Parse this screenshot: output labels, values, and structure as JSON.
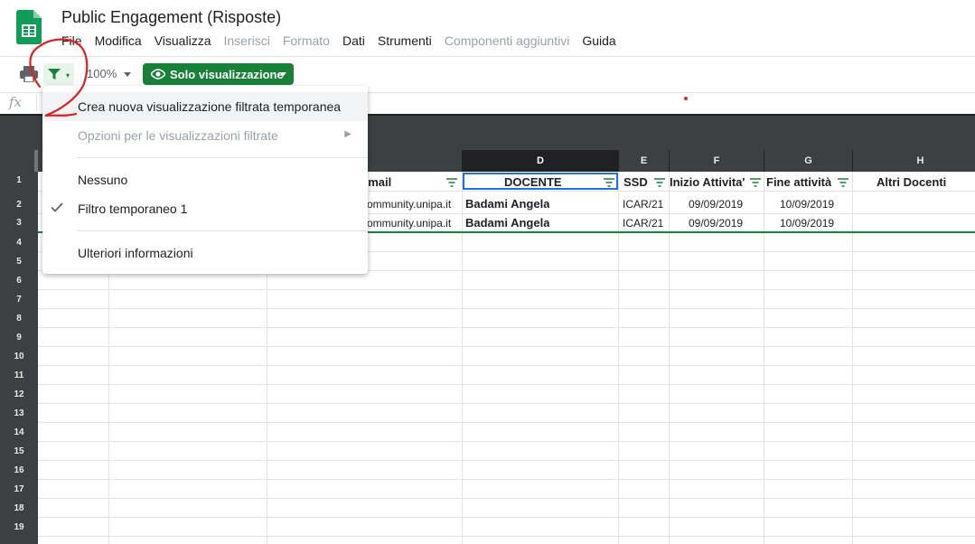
{
  "app": {
    "title": "Public Engagement (Risposte)"
  },
  "menubar": [
    {
      "label": "File",
      "enabled": true
    },
    {
      "label": "Modifica",
      "enabled": true
    },
    {
      "label": "Visualizza",
      "enabled": true
    },
    {
      "label": "Inserisci",
      "enabled": false
    },
    {
      "label": "Formato",
      "enabled": false
    },
    {
      "label": "Dati",
      "enabled": true
    },
    {
      "label": "Strumenti",
      "enabled": true
    },
    {
      "label": "Componenti aggiuntivi",
      "enabled": false
    },
    {
      "label": "Guida",
      "enabled": true
    }
  ],
  "toolbar": {
    "zoom": "100%",
    "view_mode_label": "Solo visualizzazione"
  },
  "formula_bar": {
    "fx_label": "fx"
  },
  "sheet": {
    "columns": [
      "D",
      "E",
      "F",
      "G",
      "H"
    ],
    "row_numbers": [
      "1",
      "2",
      "3",
      "4",
      "5",
      "6",
      "7",
      "8",
      "9",
      "10",
      "11",
      "12",
      "13",
      "14",
      "15",
      "16",
      "17",
      "18",
      "19"
    ],
    "headers": {
      "email": "email",
      "docente": "DOCENTE",
      "ssd": "SSD",
      "inizio": "Inizio Attivita'",
      "fine": "Fine attività",
      "altri": "Altri Docenti"
    },
    "rows": [
      {
        "email": "community.unipa.it",
        "docente": "Badami Angela",
        "ssd": "ICAR/21",
        "inizio": "09/09/2019",
        "fine": "10/09/2019"
      },
      {
        "email": "community.unipa.it",
        "docente": "Badami Angela",
        "ssd": "ICAR/21",
        "inizio": "09/09/2019",
        "fine": "10/09/2019"
      }
    ]
  },
  "filter_menu": {
    "items": [
      {
        "label": "Crea nuova visualizzazione filtrata temporanea",
        "state": "hover"
      },
      {
        "label": "Opzioni per le visualizzazioni filtrate",
        "state": "disabled"
      },
      {
        "label": "Nessuno",
        "state": "normal"
      },
      {
        "label": "Filtro temporaneo 1",
        "state": "checked"
      },
      {
        "label": "Ulteriori informazioni",
        "state": "normal"
      }
    ]
  },
  "colors": {
    "accent_green": "#188038",
    "header_dark": "#3c4043",
    "selection_blue": "#1a73e8",
    "annotation_red": "#e02020"
  },
  "icons": [
    "sheets-logo-icon",
    "print-icon",
    "filter-icon",
    "eye-icon",
    "check-icon",
    "submenu-arrow-icon"
  ]
}
